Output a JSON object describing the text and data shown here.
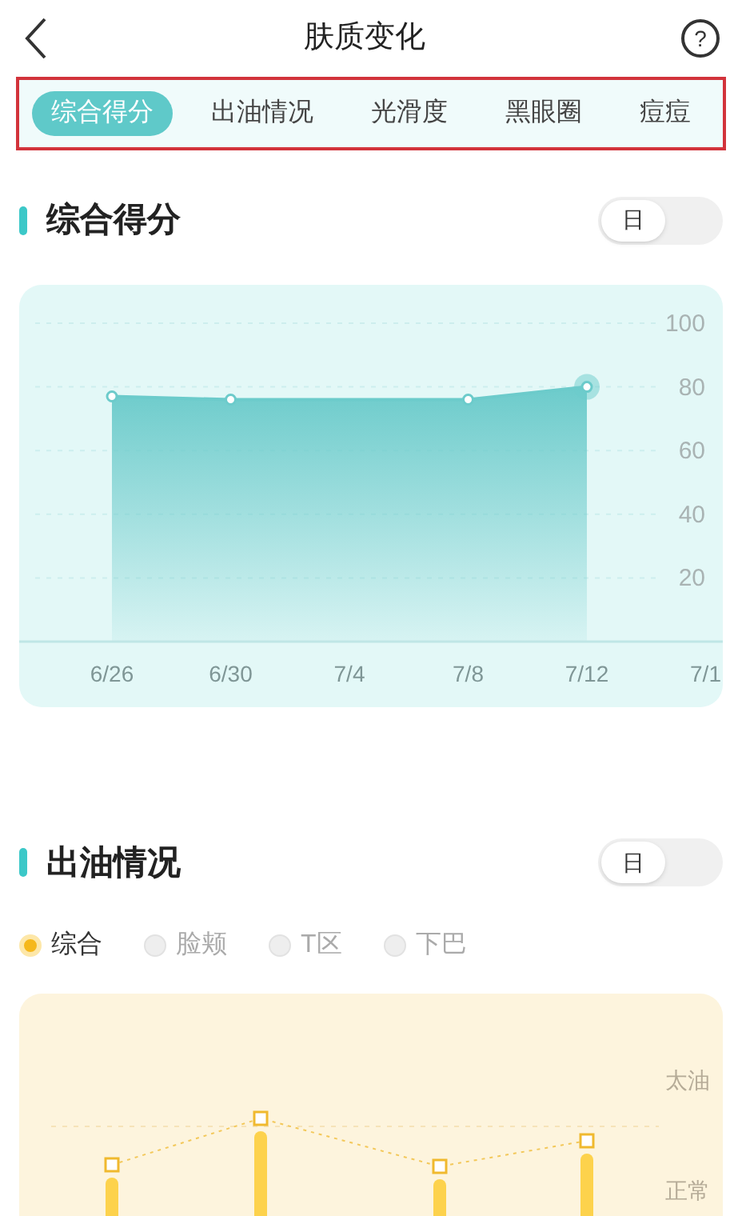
{
  "header": {
    "title": "肤质变化",
    "help_icon_text": "?"
  },
  "tabs": [
    {
      "label": "综合得分",
      "selected": true
    },
    {
      "label": "出油情况",
      "selected": false
    },
    {
      "label": "光滑度",
      "selected": false
    },
    {
      "label": "黑眼圈",
      "selected": false
    },
    {
      "label": "痘痘",
      "selected": false
    }
  ],
  "score_section": {
    "title": "综合得分",
    "toggle": {
      "label": "日"
    },
    "chart_data": {
      "type": "area",
      "categories": [
        "6/26",
        "6/30",
        "7/4",
        "7/8",
        "7/12",
        "7/1"
      ],
      "grid": true,
      "series": [
        {
          "color": "#6ccbcb",
          "values": [
            77,
            76,
            null,
            76,
            80,
            null
          ]
        }
      ],
      "yticks": [
        20,
        40,
        60,
        80,
        100
      ],
      "ylim": [
        0,
        100
      ]
    }
  },
  "oil_section": {
    "title": "出油情况",
    "toggle": {
      "label": "日"
    },
    "filters": [
      {
        "label": "综合",
        "selected": true
      },
      {
        "label": "脸颊",
        "selected": false
      },
      {
        "label": "T区",
        "selected": false
      },
      {
        "label": "下巴",
        "selected": false
      }
    ],
    "levels": [
      "太油",
      "正常"
    ]
  }
}
